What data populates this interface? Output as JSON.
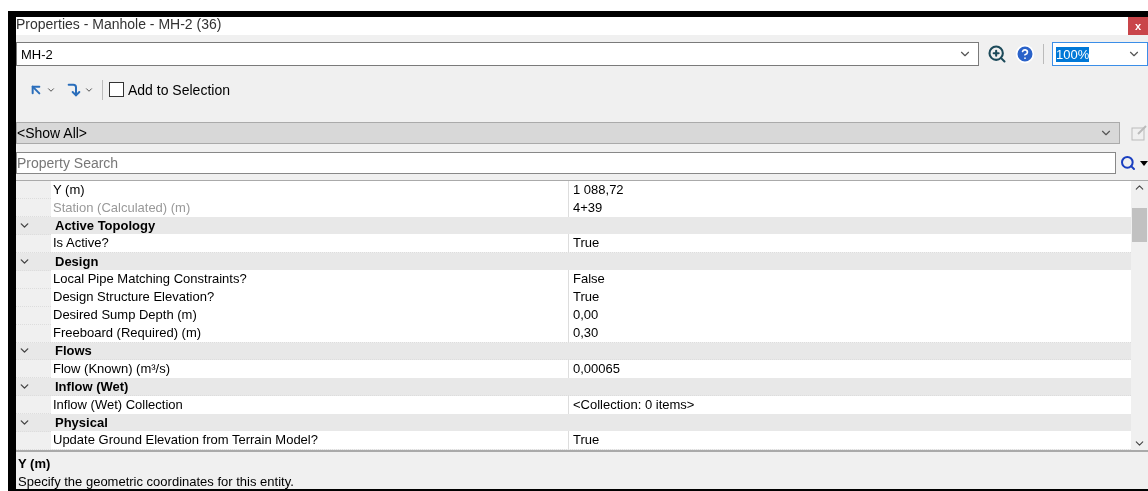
{
  "window": {
    "title": "Properties - Manhole - MH-2 (36)",
    "close": "x"
  },
  "element_selector": {
    "value": "MH-2"
  },
  "zoom": {
    "value": "100%",
    "selected": true
  },
  "toolbar": {
    "add_to_selection": {
      "label": "Add to Selection",
      "checked": false
    }
  },
  "filter": {
    "value": "<Show All>"
  },
  "search": {
    "placeholder": "Property Search"
  },
  "grid": {
    "rows": [
      {
        "kind": "property",
        "label": "Y (m)",
        "value": "1 088,72",
        "disabled": false
      },
      {
        "kind": "property",
        "label": "Station (Calculated) (m)",
        "value": "4+39",
        "disabled": true
      },
      {
        "kind": "category",
        "label": "Active Topology",
        "expanded": true
      },
      {
        "kind": "property",
        "label": "Is Active?",
        "value": "True",
        "disabled": false
      },
      {
        "kind": "category",
        "label": "Design",
        "expanded": true
      },
      {
        "kind": "property",
        "label": "Local Pipe Matching Constraints?",
        "value": "False",
        "disabled": false
      },
      {
        "kind": "property",
        "label": "Design Structure Elevation?",
        "value": "True",
        "disabled": false
      },
      {
        "kind": "property",
        "label": "Desired Sump Depth (m)",
        "value": "0,00",
        "disabled": false
      },
      {
        "kind": "property",
        "label": "Freeboard (Required) (m)",
        "value": "0,30",
        "disabled": false
      },
      {
        "kind": "category",
        "label": "Flows",
        "expanded": true
      },
      {
        "kind": "property",
        "label": "Flow (Known) (m³/s)",
        "value": "0,00065",
        "disabled": false
      },
      {
        "kind": "category",
        "label": "Inflow (Wet)",
        "expanded": true
      },
      {
        "kind": "property",
        "label": "Inflow (Wet) Collection",
        "value": "<Collection: 0 items>",
        "disabled": false
      },
      {
        "kind": "category",
        "label": "Physical",
        "expanded": true
      },
      {
        "kind": "property",
        "label": "Update Ground Elevation from Terrain Model?",
        "value": "True",
        "disabled": false
      }
    ]
  },
  "description": {
    "title": "Y (m)",
    "text": "Specify the geometric coordinates for this entity."
  }
}
